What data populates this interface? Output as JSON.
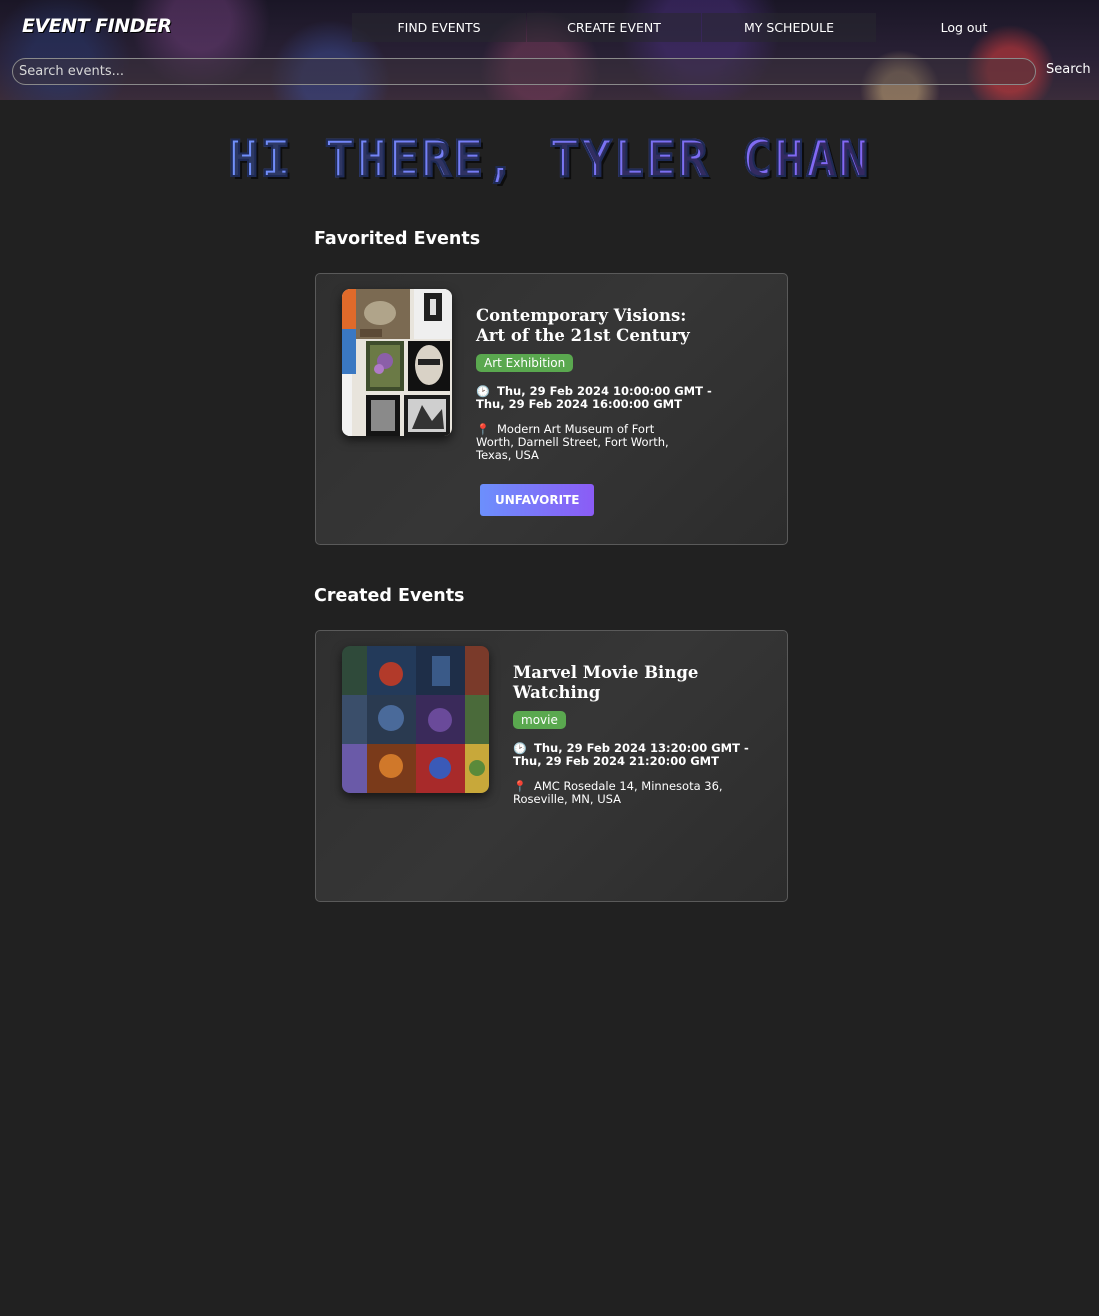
{
  "header": {
    "logo": "EVENT FINDER",
    "nav": [
      "FIND EVENTS",
      "CREATE EVENT",
      "MY SCHEDULE",
      "Log out"
    ],
    "search_placeholder": "Search events...",
    "search_button": "Search"
  },
  "greeting": "HI THERE, TYLER CHAN",
  "favorited": {
    "heading": "Favorited Events",
    "event": {
      "title": "Contemporary Visions: Art of the 21st Century",
      "tag": "Art Exhibition",
      "datetime": "Thu, 29 Feb 2024 10:00:00 GMT - Thu, 29 Feb 2024 16:00:00 GMT",
      "location": "Modern Art Museum of Fort Worth, Darnell Street, Fort Worth, Texas, USA",
      "button": "UNFAVORITE"
    }
  },
  "created": {
    "heading": "Created Events",
    "event": {
      "title": "Marvel Movie Binge Watching",
      "tag": "movie",
      "datetime": "Thu, 29 Feb 2024 13:20:00 GMT - Thu, 29 Feb 2024 21:20:00 GMT",
      "location": "AMC Rosedale 14, Minnesota 36, Roseville, MN, USA"
    }
  },
  "icons": {
    "time": "clock-icon",
    "location": "pin-icon"
  },
  "colors": {
    "tag_green": "#5aa84f",
    "button_start": "#6c8ffc",
    "button_end": "#8b5cf6",
    "page_bg": "#212121"
  }
}
